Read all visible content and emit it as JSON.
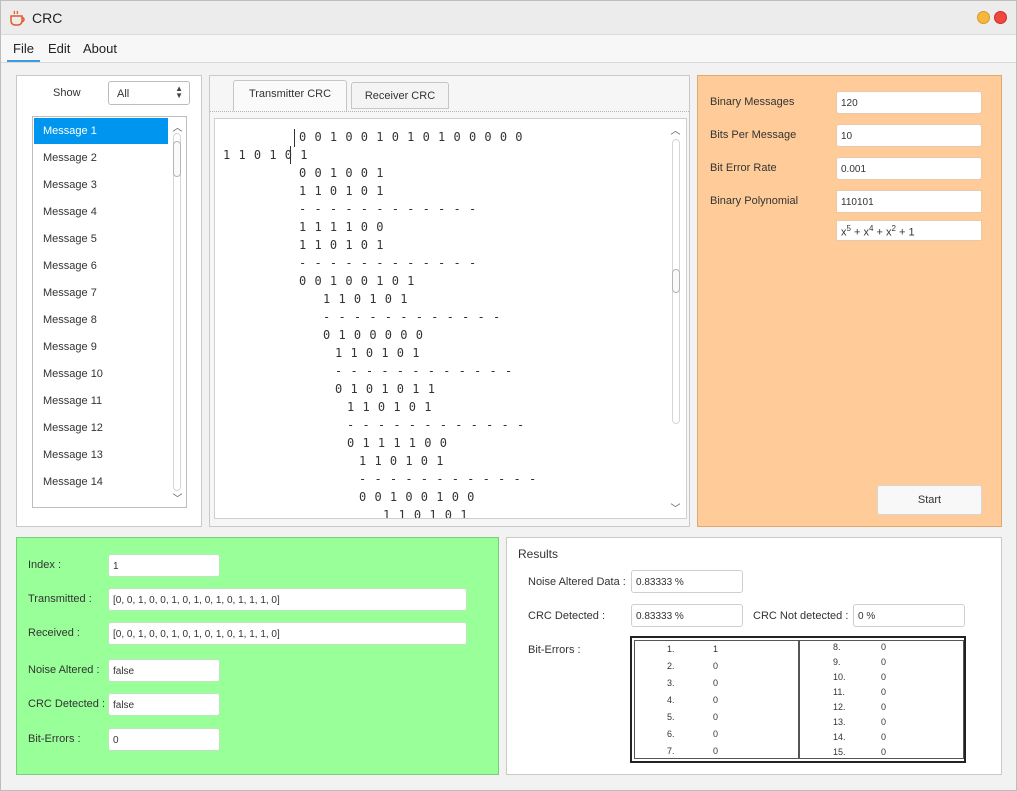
{
  "window": {
    "title": "CRC"
  },
  "menu": {
    "file": "File",
    "edit": "Edit",
    "about": "About"
  },
  "sidebar": {
    "show_label": "Show",
    "show_value": "All",
    "messages": [
      "Message 1",
      "Message 2",
      "Message 3",
      "Message 4",
      "Message 5",
      "Message 6",
      "Message 7",
      "Message 8",
      "Message 9",
      "Message 10",
      "Message 11",
      "Message 12",
      "Message 13",
      "Message 14"
    ]
  },
  "tabs": {
    "transmitter": "Transmitter CRC",
    "receiver": "Receiver CRC"
  },
  "division": {
    "dividend": "0 0 1 0 0 1 0 1 0 1 0 0 0 0 0",
    "divisor": "1 1 0 1 0 1",
    "lines": [
      "0 0 1 0 0 1",
      "1 1 0 1 0 1",
      "- - - - - - - - - - - -",
      "1 1 1 1 0 0",
      "1 1 0 1 0 1",
      "- - - - - - - - - - - -",
      "0 0 1 0 0 1 0 1",
      "1 1 0 1 0 1",
      "- - - - - - - - - - - -",
      "0 1 0 0 0 0 0",
      "1 1 0 1 0 1",
      "- - - - - - - - - - - -",
      "0 1 0 1 0 1 1",
      "1 1 0 1 0 1",
      "- - - - - - - - - - - -",
      "0 1 1 1 1 0 0",
      "1 1 0 1 0 1",
      "- - - - - - - - - - - -",
      "0 0 1 0 0 1 0 0",
      "1 1 0 1 0 1",
      "- - - - - - - - - - - -"
    ]
  },
  "params": {
    "binary_messages_label": "Binary Messages",
    "binary_messages_value": "120",
    "bits_per_message_label": "Bits Per Message",
    "bits_per_message_value": "10",
    "bit_error_rate_label": "Bit Error Rate",
    "bit_error_rate_value": "0.001",
    "polynomial_label": "Binary Polynomial",
    "polynomial_value": "110101",
    "polynomial_expr": {
      "t1": "x",
      "e1": "5",
      "t2": " + x",
      "e2": "4",
      "t3": " + x",
      "e3": "2",
      "t4": " + 1"
    },
    "start_label": "Start"
  },
  "details": {
    "index_label": "Index :",
    "index_value": "1",
    "transmitted_label": "Transmitted :",
    "transmitted_value": "[0, 0, 1, 0, 0, 1, 0, 1, 0, 1, 0, 1, 1, 1, 0]",
    "received_label": "Received :",
    "received_value": "[0, 0, 1, 0, 0, 1, 0, 1, 0, 1, 0, 1, 1, 1, 0]",
    "noise_label": "Noise Altered :",
    "noise_value": "false",
    "crc_label": "CRC Detected :",
    "crc_value": "false",
    "biterrors_label": "Bit-Errors :",
    "biterrors_value": "0"
  },
  "results": {
    "title": "Results",
    "noise_label": "Noise Altered Data :",
    "noise_value": "0.83333 %",
    "crc_detected_label": "CRC Detected :",
    "crc_detected_value": "0.83333 %",
    "crc_not_label": "CRC Not detected :",
    "crc_not_value": "0 %",
    "biterrors_label": "Bit-Errors :",
    "bit_errors": [
      {
        "k": "1.",
        "v": "1"
      },
      {
        "k": "2.",
        "v": "0"
      },
      {
        "k": "3.",
        "v": "0"
      },
      {
        "k": "4.",
        "v": "0"
      },
      {
        "k": "5.",
        "v": "0"
      },
      {
        "k": "6.",
        "v": "0"
      },
      {
        "k": "7.",
        "v": "0"
      },
      {
        "k": "8.",
        "v": "0"
      },
      {
        "k": "9.",
        "v": "0"
      },
      {
        "k": "10.",
        "v": "0"
      },
      {
        "k": "11.",
        "v": "0"
      },
      {
        "k": "12.",
        "v": "0"
      },
      {
        "k": "13.",
        "v": "0"
      },
      {
        "k": "14.",
        "v": "0"
      },
      {
        "k": "15.",
        "v": "0"
      }
    ]
  }
}
